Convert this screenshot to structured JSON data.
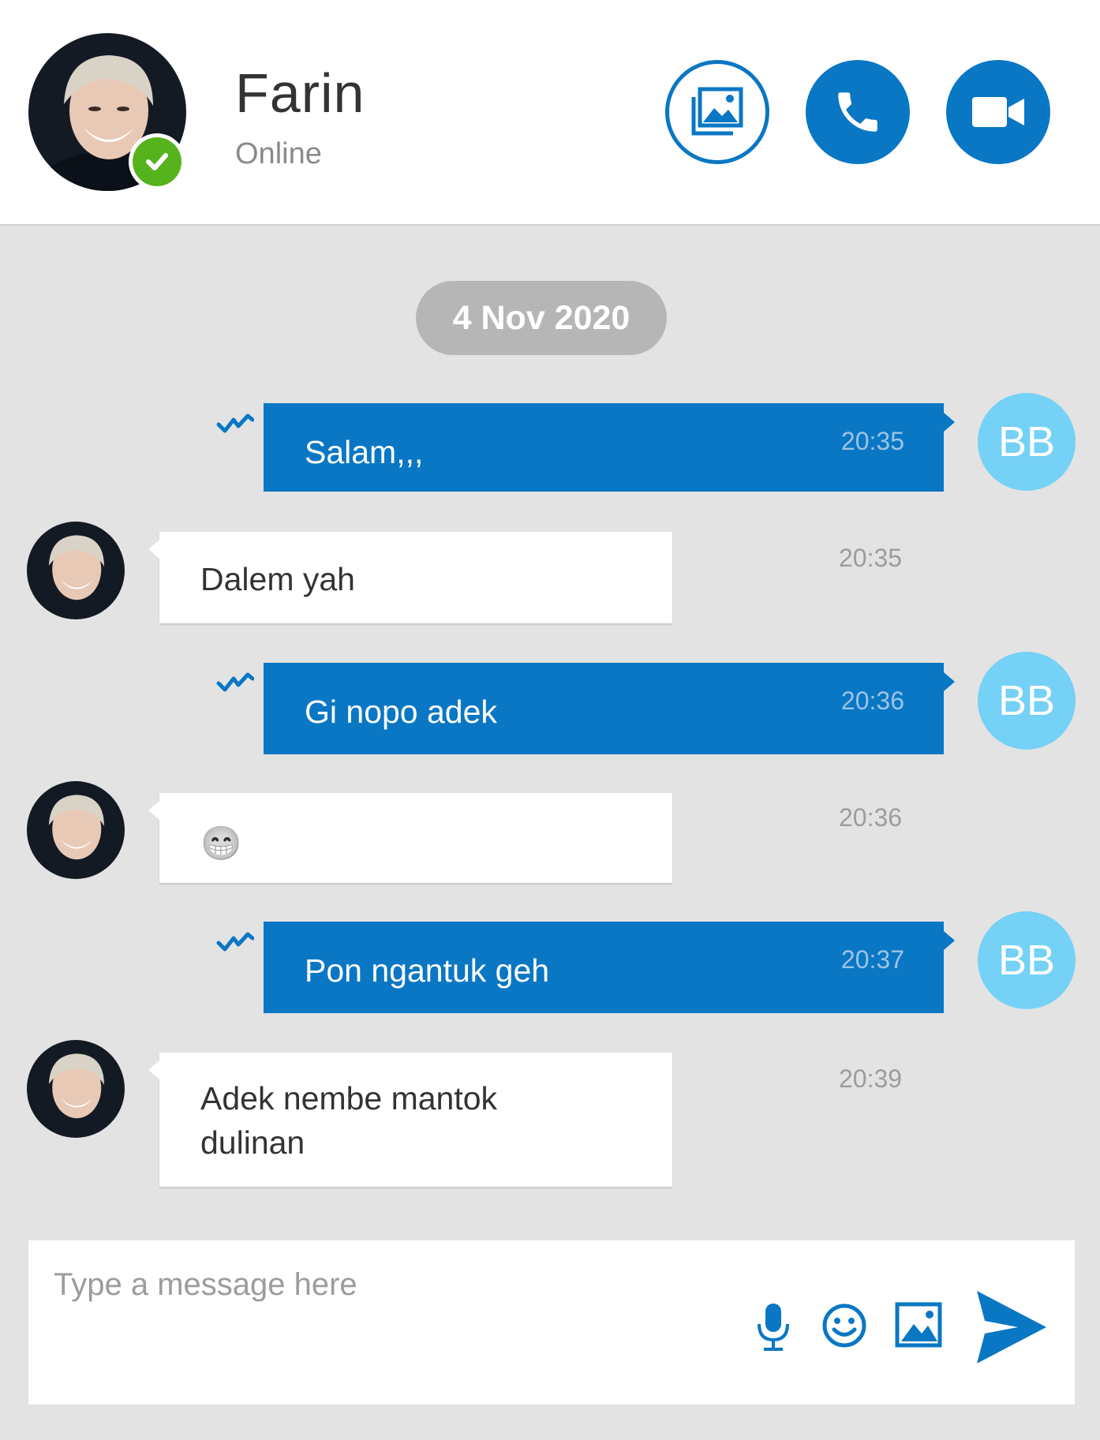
{
  "header": {
    "contact_name": "Farin",
    "status": "Online",
    "buttons": {
      "gallery_icon": "image-gallery-icon",
      "call_icon": "phone-icon",
      "video_icon": "video-camera-icon"
    },
    "presence_icon": "check-icon"
  },
  "date_separator": "4 Nov 2020",
  "messages": [
    {
      "direction": "out",
      "text": "Salam,,,",
      "time": "20:35",
      "avatar": "BB"
    },
    {
      "direction": "in",
      "text": "Dalem yah",
      "time": "20:35"
    },
    {
      "direction": "out",
      "text": "Gi nopo adek",
      "time": "20:36",
      "avatar": "BB"
    },
    {
      "direction": "in",
      "text": "😁",
      "time": "20:36",
      "emoji_icon": "grinning-face-icon"
    },
    {
      "direction": "out",
      "text": "Pon ngantuk geh",
      "time": "20:37",
      "avatar": "BB"
    },
    {
      "direction": "in",
      "text": "Adek nembe mantok dulinan",
      "time": "20:39"
    }
  ],
  "composer": {
    "placeholder": "Type a message here",
    "icons": [
      "microphone-icon",
      "smiley-icon",
      "image-icon",
      "send-icon"
    ]
  },
  "colors": {
    "accent": "#0a77c4",
    "outgoing_avatar": "#75d1f5",
    "presence": "#57b31d",
    "background": "#e3e3e3"
  }
}
